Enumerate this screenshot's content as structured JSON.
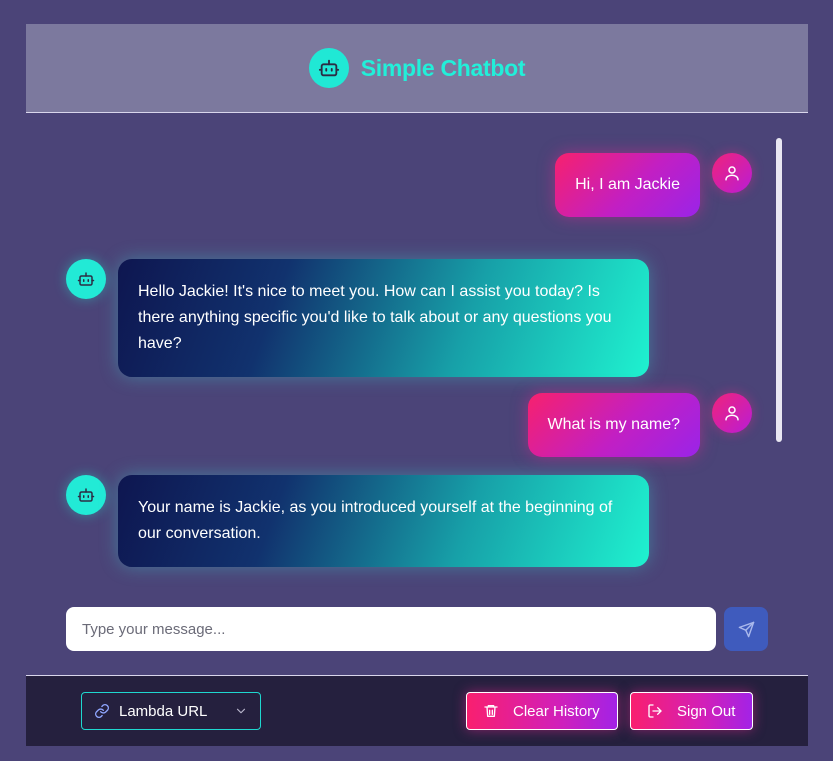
{
  "header": {
    "title": "Simple Chatbot",
    "logo_icon": "robot-icon"
  },
  "messages": [
    {
      "role": "user",
      "text": "Hi, I am Jackie"
    },
    {
      "role": "bot",
      "text": "Hello Jackie! It's nice to meet you. How can I assist you today? Is there anything specific you'd like to talk about or any questions you have?"
    },
    {
      "role": "user",
      "text": "What is my name?"
    },
    {
      "role": "bot",
      "text": "Your name is Jackie, as you introduced yourself at the beginning of our conversation."
    }
  ],
  "composer": {
    "placeholder": "Type your message...",
    "value": "",
    "send_icon": "send-icon"
  },
  "footer": {
    "url_select": {
      "label": "Lambda URL",
      "icon": "link-icon"
    },
    "clear_button": {
      "label": "Clear History",
      "icon": "trash-icon"
    },
    "signout_button": {
      "label": "Sign Out",
      "icon": "sign-out-icon"
    }
  },
  "colors": {
    "accent_cyan": "#22efd9",
    "user_gradient": [
      "#f7216d",
      "#9a24e8"
    ],
    "bot_gradient": [
      "#0e1650",
      "#1ff2d0"
    ],
    "background": "#4b4478"
  }
}
